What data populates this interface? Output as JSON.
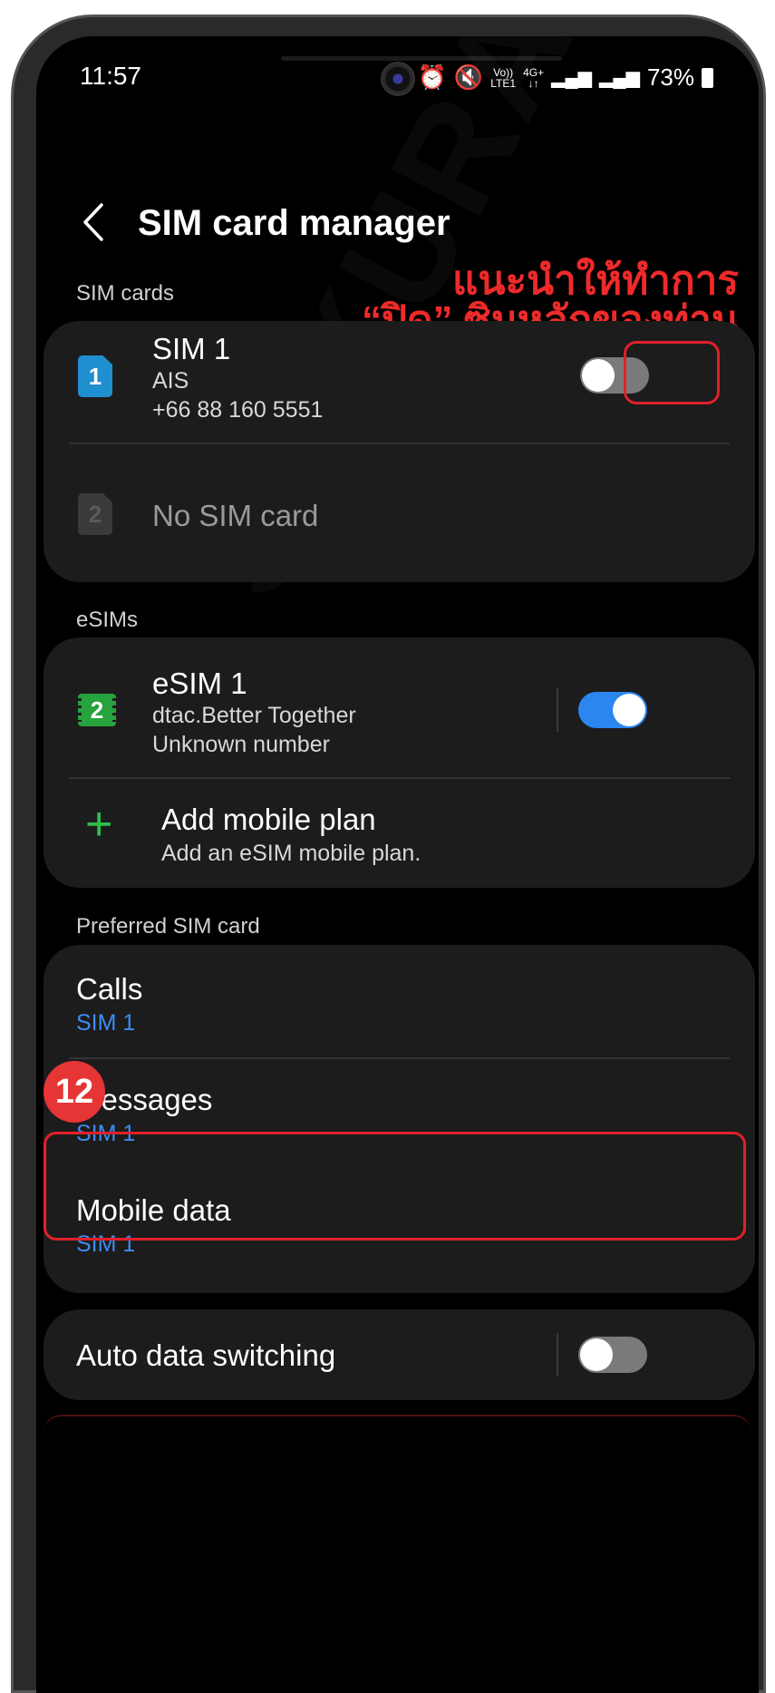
{
  "status": {
    "time": "11:57",
    "network_top": "Vo))",
    "network_bottom": "LTE1",
    "g_top": "4G+",
    "g_bottom": "↓↑",
    "battery": "73%"
  },
  "header": {
    "title": "SIM card manager"
  },
  "sim_cards": {
    "section": "SIM cards",
    "sim1": {
      "number_label": "1",
      "title": "SIM 1",
      "carrier": "AIS",
      "phone": "+66 88 160 5551",
      "enabled": false
    },
    "sim2": {
      "number_label": "2",
      "title": "No SIM card"
    }
  },
  "annotation": {
    "line1": "แนะนำให้ทำการ",
    "line2": "“ปิด” ซิมหลักของท่าน",
    "color": "#ee2a2a"
  },
  "esims": {
    "section": "eSIMs",
    "esim1": {
      "number_label": "2",
      "title": "eSIM 1",
      "carrier": "dtac.Better Together",
      "number": "Unknown number",
      "enabled": true
    },
    "add": {
      "title": "Add mobile plan",
      "subtitle": "Add an eSIM mobile plan."
    }
  },
  "preferred": {
    "section": "Preferred SIM card",
    "calls": {
      "title": "Calls",
      "value": "SIM 1"
    },
    "messages": {
      "title": "Messages",
      "value": "SIM 1"
    },
    "mobile_data": {
      "title": "Mobile data",
      "value": "SIM 1"
    }
  },
  "step_badge": "12",
  "auto_switch": {
    "title": "Auto data switching",
    "enabled": false
  },
  "watermark": "SAKURAISIM",
  "colors": {
    "accent_blue": "#2c86f0",
    "highlight_red": "#e0202a",
    "esim_green": "#27a33d"
  }
}
